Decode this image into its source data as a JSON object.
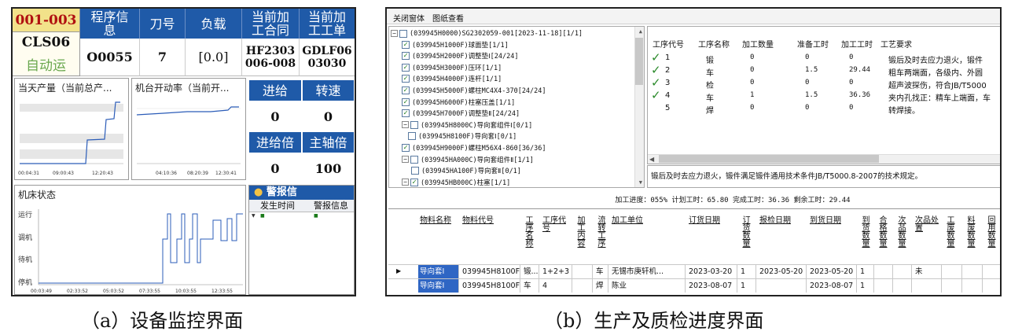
{
  "panel_a": {
    "header_cells": [
      {
        "label": "001-003"
      },
      {
        "label": "程序信息"
      },
      {
        "label": "刀号"
      },
      {
        "label": "负载"
      },
      {
        "label": "当前加工合同"
      },
      {
        "label": "当前加工工单"
      }
    ],
    "machine_code": "CLS06",
    "mode": "自动运",
    "program_no": "O0055",
    "tool_no": "7",
    "load": "[0.0]",
    "contract": "HF2303006-008",
    "work_order": "GDLF0603030",
    "output_chart": {
      "title": "当天产量（当前总产...",
      "x_ticks": [
        "00:04:31",
        "09:00:43",
        "12:20:43"
      ]
    },
    "rate_chart": {
      "title": "机台开动率（当前开...",
      "x_ticks": [
        "04:10:36",
        "08:20:39",
        "12:30:41"
      ]
    },
    "feed_block": {
      "feed_label": "进给",
      "speed_label": "转速",
      "feed_value": "0",
      "speed_value": "0",
      "feed_rate_label": "进给倍",
      "spindle_label": "主轴倍",
      "feed_rate_value": "0",
      "spindle_value": "100"
    },
    "state_chart": {
      "title": "机床状态",
      "y_labels": [
        "运行",
        "调机",
        "待机",
        "停机"
      ],
      "x_ticks": [
        "00:03:49",
        "02:33:52",
        "05:03:52",
        "07:33:55",
        "10:03:55",
        "12:33:55"
      ]
    },
    "alarm": {
      "title": "警报信",
      "col_time": "发生时间",
      "col_info": "警报信息"
    }
  },
  "panel_b": {
    "menu": [
      "关闭窗体",
      "图纸查看"
    ],
    "tree": {
      "root": "(039945H0000)SG2302059-001[2023-11-18][1/1]",
      "items": [
        {
          "text": "(039945H1000F)球面垫[1/1]",
          "checked": true
        },
        {
          "text": "(039945H2000F)调整垫Ⅰ[24/24]",
          "checked": true
        },
        {
          "text": "(039945H3000F)压环[1/1]",
          "checked": true
        },
        {
          "text": "(039945H4000F)连杆[1/1]",
          "checked": true
        },
        {
          "text": "(039945H5000F)螺柱MC4X4-370[24/24]",
          "checked": true
        },
        {
          "text": "(039945H6000F)柱塞压盖[1/1]",
          "checked": true
        },
        {
          "text": "(039945H7000F)调整垫Ⅱ[24/24]",
          "checked": true
        },
        {
          "text": "(039945H8000C)导向套组件Ⅰ[0/1]",
          "checked": false
        },
        {
          "text": "(039945H8100F)导向套Ⅰ[0/1]",
          "checked": false
        },
        {
          "text": "(039945H9000F)螺柱M56X4-860[36/36]",
          "checked": true
        },
        {
          "text": "(039945HA000C)导向套组件Ⅱ[1/1]",
          "checked": false
        },
        {
          "text": "(039945HA100F)导向套Ⅱ[0/1]",
          "checked": false
        },
        {
          "text": "(039945HB000C)柱塞[1/1]",
          "checked": true
        }
      ]
    },
    "process_table": {
      "headers": [
        "工序代号",
        "工序名称",
        "加工数量",
        "准备工时",
        "加工工时",
        "工艺要求"
      ],
      "rows": [
        {
          "code": "1",
          "name": "锻",
          "qty": "0",
          "prep": "0",
          "work": "0",
          "req": "锻后及时去应力退火，锻件",
          "done": true
        },
        {
          "code": "2",
          "name": "车",
          "qty": "0",
          "prep": "1.5",
          "work": "29.44",
          "req": "粗车两端面，各级内、外圆",
          "done": true
        },
        {
          "code": "3",
          "name": "检",
          "qty": "0",
          "prep": "0",
          "work": "0",
          "req": "超声波探伤，符合JB/T5000",
          "done": true
        },
        {
          "code": "4",
          "name": "车",
          "qty": "1",
          "prep": "1.5",
          "work": "36.36",
          "req": "夹内孔找正：精车上端面，车",
          "done": true
        },
        {
          "code": "5",
          "name": "焊",
          "qty": "0",
          "prep": "0",
          "work": "0",
          "req": "转焊接。",
          "done": false
        }
      ]
    },
    "description": "锻后及时去应力退火，锻件满足锻件通用技术条件JB/T5000.8-2007的技术规定。",
    "progress": "加工进度：055%  计划工时：65.80  完成工时：36.36  剩余工时：29.44",
    "bottom_headers": [
      "物料名称",
      "物料代号",
      "工序名称",
      "工序代号",
      "加工内容",
      "流转工序",
      "加工单位",
      "订货日期",
      "订货数量",
      "报检日期",
      "到货日期",
      "到货数量",
      "合格数量",
      "次品数量",
      "次品处置",
      "工废数量",
      "料废数量",
      "回用数量"
    ],
    "bottom_rows": [
      [
        "导向套Ⅰ",
        "039945H8100F",
        "锻...",
        "1+2+3",
        "",
        "车",
        "无锡市庚轩机...",
        "2023-03-20",
        "1",
        "2023-05-20",
        "2023-05-20",
        "1",
        "",
        "",
        "未",
        "",
        "",
        ""
      ],
      [
        "导向套Ⅰ",
        "039945H8100F",
        "车",
        "4",
        "",
        "焊",
        "陈业",
        "2023-08-07",
        "1",
        "",
        "2023-08-07",
        "1",
        "",
        "",
        "",
        "",
        "",
        ""
      ]
    ]
  },
  "captions": {
    "a": "（a）设备监控界面",
    "b": "（b）生产及质检进度界面"
  },
  "colors": {
    "header_blue": "#1f5aa8",
    "header_gold": "#f2e28a",
    "line_blue": "#2b5cb8",
    "check_green": "#2a8a2a",
    "mode_green": "#6aa84f"
  }
}
